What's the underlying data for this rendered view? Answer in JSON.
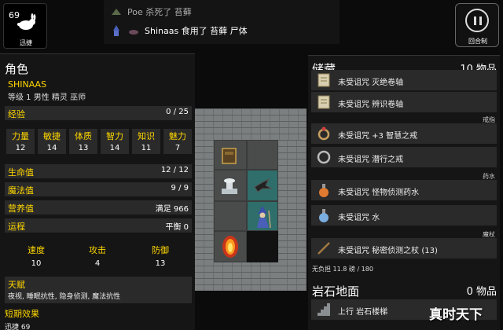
{
  "hero": {
    "level": "69",
    "label": "迅捷"
  },
  "log": [
    {
      "text": "Poe 杀死了 苔藓",
      "color": "#aaaaaa"
    },
    {
      "text": "Shinaas 食用了 苔藓 尸体",
      "color": "#ffffff"
    }
  ],
  "pause": {
    "label": "回合制"
  },
  "character": {
    "title": "角色",
    "name": "SHINAAS",
    "desc": "等级 1 男性 精灵 巫师",
    "exp": {
      "label": "经验",
      "value": "0 / 25"
    },
    "attributes": [
      {
        "label": "力量",
        "value": "12"
      },
      {
        "label": "敏捷",
        "value": "14"
      },
      {
        "label": "体质",
        "value": "13"
      },
      {
        "label": "智力",
        "value": "14"
      },
      {
        "label": "知识",
        "value": "11"
      },
      {
        "label": "魅力",
        "value": "7"
      }
    ],
    "stats": [
      {
        "label": "生命值",
        "value": "12 / 12"
      },
      {
        "label": "魔法值",
        "value": "9 / 9"
      },
      {
        "label": "营养值",
        "value": "满足 966"
      },
      {
        "label": "运程",
        "value": "平衡 0"
      }
    ],
    "combat": [
      {
        "label": "速度",
        "value": "10"
      },
      {
        "label": "攻击",
        "value": "4"
      },
      {
        "label": "防御",
        "value": "13"
      }
    ],
    "talent": {
      "label": "天赋",
      "value": "夜视, 睡眠抗性, 隐身侦测, 魔法抗性"
    },
    "buffs": {
      "label": "短期效果",
      "value": "迅捷 69"
    }
  },
  "inventory": {
    "title": "储藏",
    "count": "10 物品",
    "categories": {
      "rings": "戒指",
      "potions": "药水",
      "wands": "魔杖"
    },
    "items": [
      {
        "name": "未受诅咒 灭绝卷轴",
        "icon": "scroll-icon"
      },
      {
        "name": "未受诅咒 辨识卷轴",
        "icon": "scroll-icon"
      },
      {
        "name": "未受诅咒 +3 智慧之戒",
        "icon": "ring-icon"
      },
      {
        "name": "未受诅咒 潜行之戒",
        "icon": "ring-icon"
      },
      {
        "name": "未受诅咒 怪物侦测药水",
        "icon": "potion-icon"
      },
      {
        "name": "未受诅咒 水",
        "icon": "potion-icon"
      },
      {
        "name": "未受诅咒 秘密侦测之杖 (13)",
        "icon": "wand-icon"
      }
    ],
    "weight": "无负担 11.8 磅 / 180",
    "ground_title": "岩石地面",
    "ground_count": "0 物品",
    "ground_item": "上行 岩石楼梯"
  },
  "watermark": "真时天下"
}
